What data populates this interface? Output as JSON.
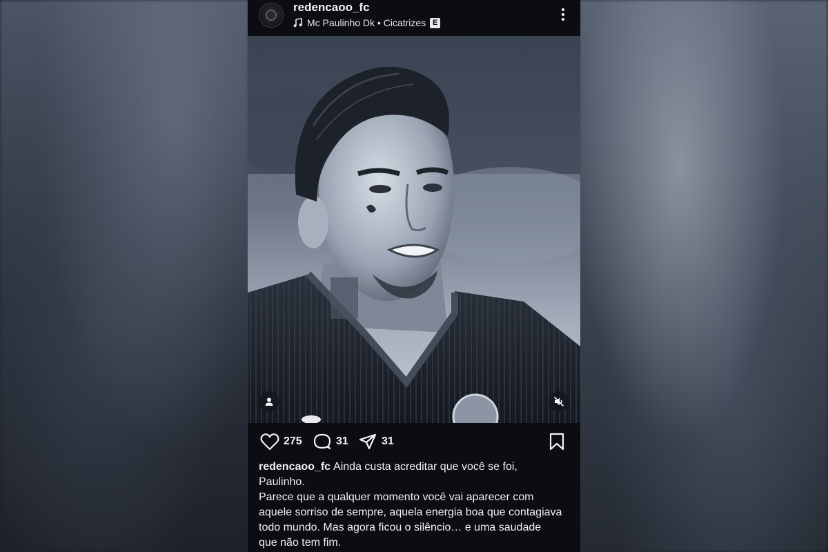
{
  "post": {
    "username": "redencaoo_fc",
    "music": {
      "artist_track": "Mc Paulinho Dk • Cicatrizes",
      "explicit_badge": "E"
    },
    "actions": {
      "likes": "275",
      "comments": "31",
      "shares": "31"
    },
    "caption": {
      "username": "redencaoo_fc",
      "line1": "Ainda custa acreditar que você se foi, Paulinho.",
      "line2": "Parece que a qualquer momento você vai aparecer com aquele sorriso de sempre, aquela energia boa que contagiava todo mundo. Mas agora ficou o silêncio… e uma saudade que não tem fim."
    }
  },
  "icons": {
    "more": "more-vertical-icon",
    "music": "music-note-icon",
    "tag": "user-tag-icon",
    "mute": "speaker-muted-icon",
    "like": "heart-icon",
    "comment": "comment-bubble-icon",
    "share": "paper-plane-icon",
    "save": "bookmark-icon"
  },
  "colors": {
    "background": "#0b0d12",
    "text": "#f2f2f2"
  }
}
